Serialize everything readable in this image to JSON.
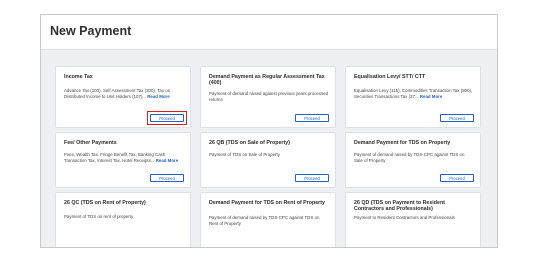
{
  "page": {
    "title": "New Payment"
  },
  "cards": [
    {
      "title": "Income Tax",
      "desc": "Advance Tax (100), Self Assessment Tax (300), Tax on Distributed Income to Unit Holders (107)...",
      "read_more": "Read More",
      "proceed_label": "Proceed",
      "highlighted": true
    },
    {
      "title": "Demand Payment as Regular Assessment Tax (400)",
      "desc": "Payment of demand raised against previous years processed returns",
      "read_more": "",
      "proceed_label": "Proceed",
      "highlighted": false
    },
    {
      "title": "Equalisation Levy/ STT/ CTT",
      "desc": "Equalisation Levy (115), Commodities Transaction Tax (800), Securities Transactions Tax (37...",
      "read_more": "Read More",
      "proceed_label": "Proceed",
      "highlighted": false
    },
    {
      "title": "Fee/ Other Payments",
      "desc": "Fees, Wealth Tax, Fringe Benefit Tax, Banking Cash Transaction Tax, Interest Tax, Hotel Receipts...",
      "read_more": "Read More",
      "proceed_label": "Proceed",
      "highlighted": false
    },
    {
      "title": "26 QB (TDS on Sale of Property)",
      "desc": "Payment of TDS on Sale of Property",
      "read_more": "",
      "proceed_label": "Proceed",
      "highlighted": false
    },
    {
      "title": "Demand Payment for TDS on Property",
      "desc": "Payment of demand raised by TDS-CPC against TDS on Sale of Property",
      "read_more": "",
      "proceed_label": "Proceed",
      "highlighted": false
    },
    {
      "title": "26 QC (TDS on Rent of Property)",
      "desc": "Payment of TDS on rent of property",
      "read_more": "",
      "proceed_label": "",
      "highlighted": false
    },
    {
      "title": "Demand Payment for TDS on Rent of Property",
      "desc": "Payment of demand raised by TDS-CPC against TDS on Rent of Property",
      "read_more": "",
      "proceed_label": "",
      "highlighted": false
    },
    {
      "title": "26 QD (TDS on Payment to Resident Contractors and Professionals)",
      "desc": "Payment to Resident Contractors and Professionals",
      "read_more": "",
      "proceed_label": "",
      "highlighted": false
    }
  ],
  "colors": {
    "accent": "#2660c5",
    "highlight": "#d21f1f",
    "background": "#eef0f3"
  }
}
